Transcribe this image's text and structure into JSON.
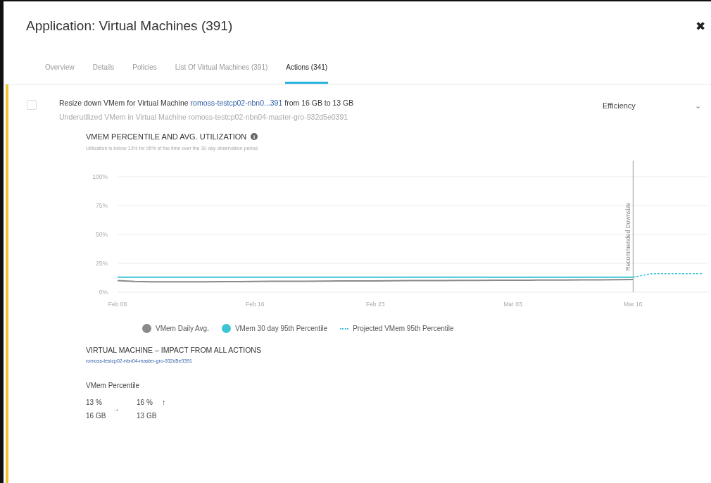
{
  "window": {
    "title": "Application: Virtual Machines (391)",
    "close": "✖"
  },
  "tabs": [
    {
      "label": "Overview",
      "selected": false
    },
    {
      "label": "Details",
      "selected": false
    },
    {
      "label": "Policies",
      "selected": false
    },
    {
      "label": "List Of Virtual Machines (391)",
      "selected": false
    },
    {
      "label": "Actions (341)",
      "selected": true
    }
  ],
  "action": {
    "checked": false,
    "title_before": "Resize down VMem for Virtual Machine ",
    "title_link": "romoss-testcp02-nbn0...391",
    "title_after": " from 16 GB to 13 GB",
    "subtitle": "Underutilized VMem in Virtual Machine romoss-testcp02-nbn04-master-gro-932d5e0391",
    "category": "Efficiency",
    "chevron": "⌄"
  },
  "chart_section": {
    "title": "VMEM PERCENTILE AND AVG. UTILIZATION",
    "info": "i",
    "note": "Utilization is below 13% for 95% of the time over the 30 day observation period",
    "chart_data": {
      "type": "line",
      "categories": [
        "Feb 08",
        null,
        null,
        null,
        null,
        null,
        null,
        null,
        "Feb 16",
        null,
        null,
        null,
        null,
        null,
        null,
        "Feb 23",
        null,
        null,
        null,
        null,
        null,
        null,
        null,
        "Mar 03",
        null,
        null,
        null,
        null,
        null,
        null,
        "Mar 10",
        null,
        null,
        null,
        null
      ],
      "series": [
        {
          "name": "VMem Daily Avg.",
          "color": "#8a8a8a",
          "line_style": "solid",
          "values": [
            10,
            9.3,
            9,
            9,
            9,
            9,
            9.2,
            9.2,
            9.3,
            9.4,
            9.5,
            9.5,
            9.6,
            9.7,
            9.8,
            9.8,
            9.9,
            10,
            10,
            10.1,
            10.2,
            10.2,
            10.3,
            10.3,
            10.4,
            10.5,
            10.5,
            10.6,
            10.7,
            10.8,
            10.9,
            null,
            null,
            null,
            null
          ]
        },
        {
          "name": "VMem 30 day 95th Percentile",
          "color": "#3cc4d6",
          "line_style": "solid",
          "values": [
            13,
            13,
            13,
            13,
            13,
            13,
            13,
            13,
            13,
            13,
            13,
            13,
            13,
            13,
            13,
            13,
            13,
            13,
            13,
            13,
            13,
            13,
            13,
            13,
            13,
            13,
            13,
            13,
            13,
            13,
            13,
            null,
            null,
            null,
            null
          ]
        },
        {
          "name": "Projected VMem 95th Percentile",
          "color": "#3cc4d6",
          "line_style": "dashed",
          "values": [
            null,
            null,
            null,
            null,
            null,
            null,
            null,
            null,
            null,
            null,
            null,
            null,
            null,
            null,
            null,
            null,
            null,
            null,
            null,
            null,
            null,
            null,
            null,
            null,
            null,
            null,
            null,
            null,
            null,
            null,
            13,
            16,
            16,
            16,
            16
          ]
        }
      ],
      "ylim": [
        0,
        100
      ],
      "grid": true,
      "yticks": [
        {
          "value": 0,
          "label": "0%"
        },
        {
          "value": 25,
          "label": "25%"
        },
        {
          "value": 50,
          "label": "50%"
        },
        {
          "value": 75,
          "label": "75%"
        },
        {
          "value": 100,
          "label": "100%"
        }
      ],
      "annotations": [
        "Recommended Downsize"
      ]
    }
  },
  "impact": {
    "title": "VIRTUAL MACHINE – IMPACT FROM ALL ACTIONS",
    "link": "romoss-testcp02-nbn04-master-gro-932d5e0391",
    "metric": "VMem Percentile",
    "before_pct": "13 %",
    "before_size": "16 GB",
    "arrow": "→",
    "after_pct": "16 %",
    "after_size": "13 GB",
    "trend": "↑"
  }
}
